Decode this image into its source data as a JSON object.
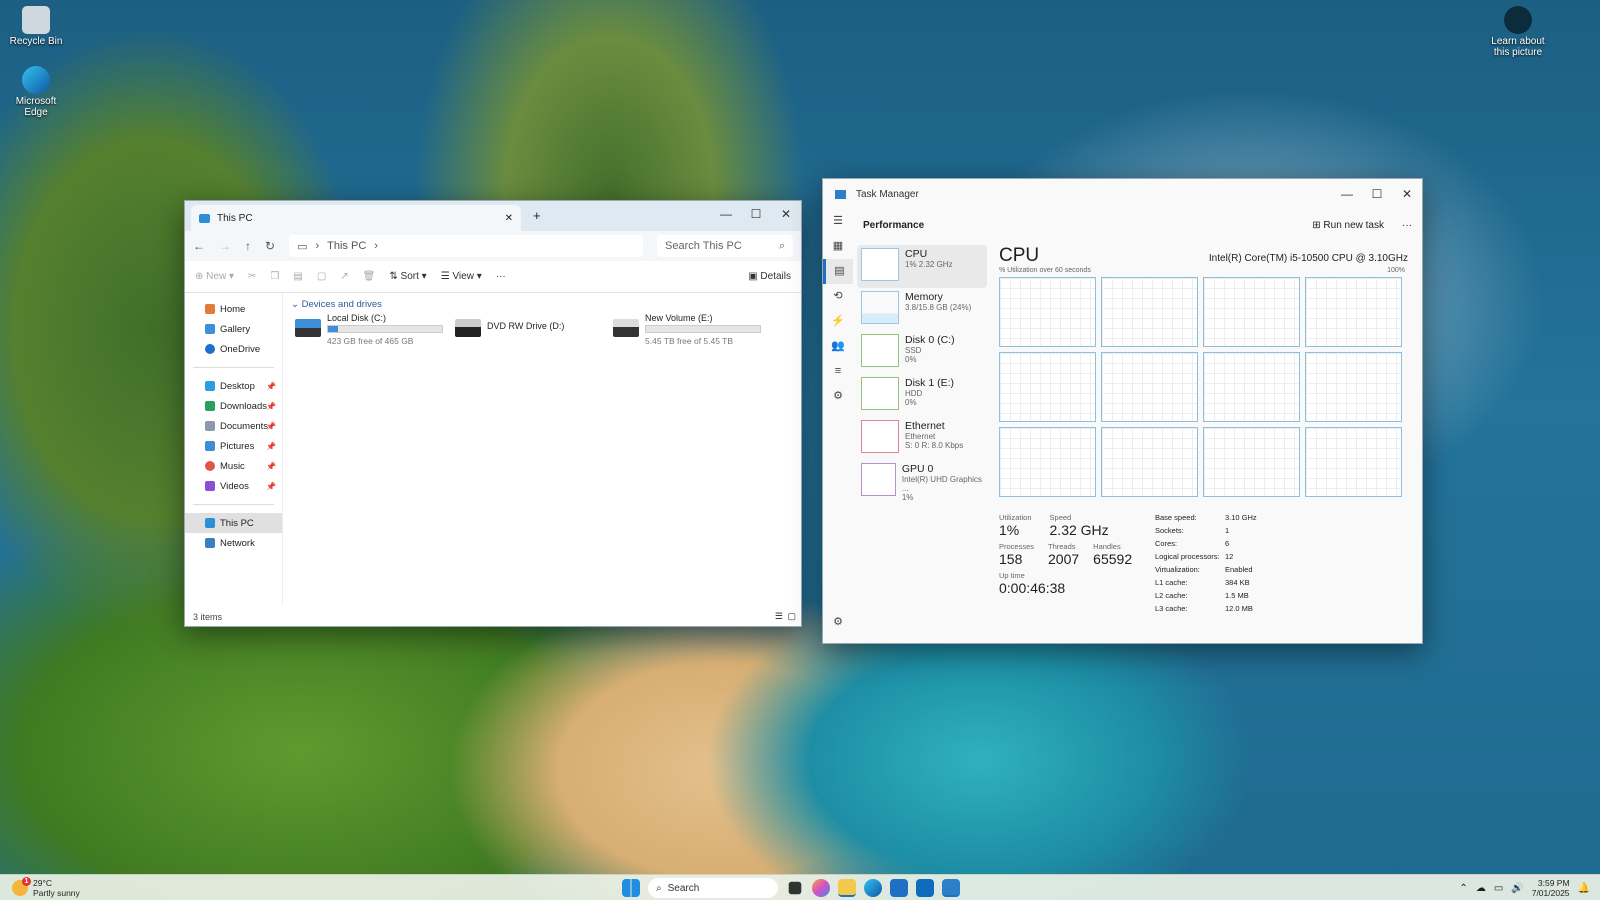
{
  "desktop": {
    "recycle": "Recycle Bin",
    "edge": "Microsoft Edge",
    "learn": "Learn about this picture"
  },
  "explorer": {
    "tab_title": "This PC",
    "window_controls": [
      "—",
      "☐",
      "✕"
    ],
    "address": "This PC",
    "search_placeholder": "Search This PC",
    "cmd": {
      "new": "New",
      "sort": "Sort",
      "view": "View",
      "more": "···",
      "details": "Details"
    },
    "sidebar": {
      "items": [
        "Home",
        "Gallery",
        "OneDrive"
      ],
      "pinned": [
        "Desktop",
        "Downloads",
        "Documents",
        "Pictures",
        "Music",
        "Videos"
      ],
      "bottom": [
        "This PC",
        "Network"
      ]
    },
    "group": "Devices and drives",
    "drives": [
      {
        "name": "Local Disk (C:)",
        "free": "423 GB free of 465 GB",
        "used": 0.09
      },
      {
        "name": "DVD RW Drive (D:)",
        "free": "",
        "used": 0
      },
      {
        "name": "New Volume (E:)",
        "free": "5.45 TB free of 5.45 TB",
        "used": 0
      }
    ],
    "status": "3 items"
  },
  "taskmgr": {
    "title": "Task Manager",
    "section": "Performance",
    "run_task": "Run new task",
    "more": "···",
    "list": [
      {
        "t1": "CPU",
        "t2": "1% 2.32 GHz",
        "t3": ""
      },
      {
        "t1": "Memory",
        "t2": "3.8/15.8 GB (24%)",
        "t3": ""
      },
      {
        "t1": "Disk 0 (C:)",
        "t2": "SSD",
        "t3": "0%"
      },
      {
        "t1": "Disk 1 (E:)",
        "t2": "HDD",
        "t3": "0%"
      },
      {
        "t1": "Ethernet",
        "t2": "Ethernet",
        "t3": "S: 0 R: 8.0 Kbps"
      },
      {
        "t1": "GPU 0",
        "t2": "Intel(R) UHD Graphics ...",
        "t3": "1%"
      }
    ],
    "cpu": {
      "heading": "CPU",
      "model": "Intel(R) Core(TM) i5-10500 CPU @ 3.10GHz",
      "util_label": "% Utilization over 60 seconds",
      "max": "100%"
    },
    "stats": {
      "utilization_l": "Utilization",
      "utilization": "1%",
      "speed_l": "Speed",
      "speed": "2.32 GHz",
      "processes_l": "Processes",
      "processes": "158",
      "threads_l": "Threads",
      "threads": "2007",
      "handles_l": "Handles",
      "handles": "65592",
      "uptime_l": "Up time",
      "uptime": "0:00:46:38"
    },
    "details": [
      [
        "Base speed:",
        "3.10 GHz"
      ],
      [
        "Sockets:",
        "1"
      ],
      [
        "Cores:",
        "6"
      ],
      [
        "Logical processors:",
        "12"
      ],
      [
        "Virtualization:",
        "Enabled"
      ],
      [
        "L1 cache:",
        "384 KB"
      ],
      [
        "L2 cache:",
        "1.5 MB"
      ],
      [
        "L3 cache:",
        "12.0 MB"
      ]
    ]
  },
  "taskbar": {
    "temp": "29°C",
    "weather": "Partly sunny",
    "search": "Search",
    "time": "3:59 PM",
    "date": "7/01/2025",
    "badge": "1"
  }
}
